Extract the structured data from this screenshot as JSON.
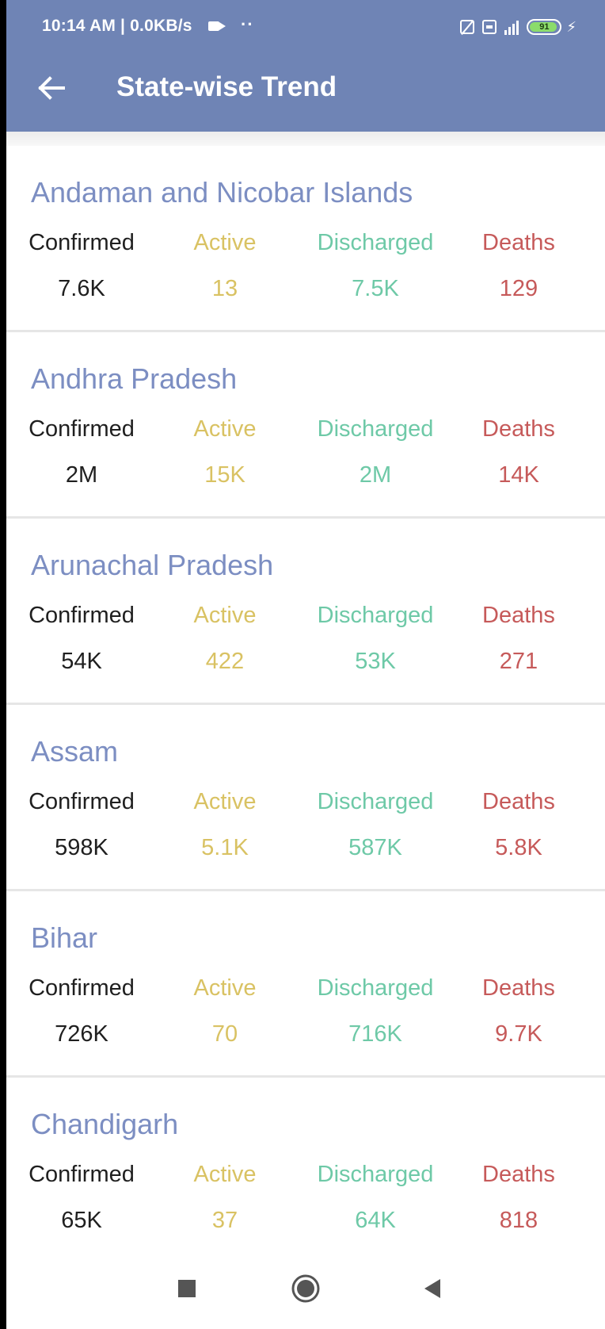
{
  "status_bar": {
    "time_speed": "10:14 AM | 0.0KB/s",
    "dots": "··",
    "battery": "91",
    "icons": [
      "screen-off-icon",
      "hd-voice-icon",
      "signal-icon",
      "battery-icon",
      "charging-bolt-icon",
      "video-camera-icon"
    ]
  },
  "app_bar": {
    "title": "State-wise Trend",
    "back_icon": "arrow-left-icon",
    "background": "#6f84b5"
  },
  "labels": {
    "confirmed": "Confirmed",
    "active": "Active",
    "discharged": "Discharged",
    "deaths": "Deaths"
  },
  "colors": {
    "state_name": "#7c8ec2",
    "confirmed": "#1f1f1f",
    "active": "#d9c263",
    "discharged": "#6ec9a7",
    "deaths": "#c65a5a"
  },
  "states": [
    {
      "name": "Andaman and Nicobar Islands",
      "confirmed": "7.6K",
      "active": "13",
      "discharged": "7.5K",
      "deaths": "129"
    },
    {
      "name": "Andhra Pradesh",
      "confirmed": "2M",
      "active": "15K",
      "discharged": "2M",
      "deaths": "14K"
    },
    {
      "name": "Arunachal Pradesh",
      "confirmed": "54K",
      "active": "422",
      "discharged": "53K",
      "deaths": "271"
    },
    {
      "name": "Assam",
      "confirmed": "598K",
      "active": "5.1K",
      "discharged": "587K",
      "deaths": "5.8K"
    },
    {
      "name": "Bihar",
      "confirmed": "726K",
      "active": "70",
      "discharged": "716K",
      "deaths": "9.7K"
    },
    {
      "name": "Chandigarh",
      "confirmed": "65K",
      "active": "37",
      "discharged": "64K",
      "deaths": "818"
    }
  ],
  "nav_bar": {
    "icons": [
      "recents-square-icon",
      "home-circle-icon",
      "back-triangle-icon"
    ]
  }
}
